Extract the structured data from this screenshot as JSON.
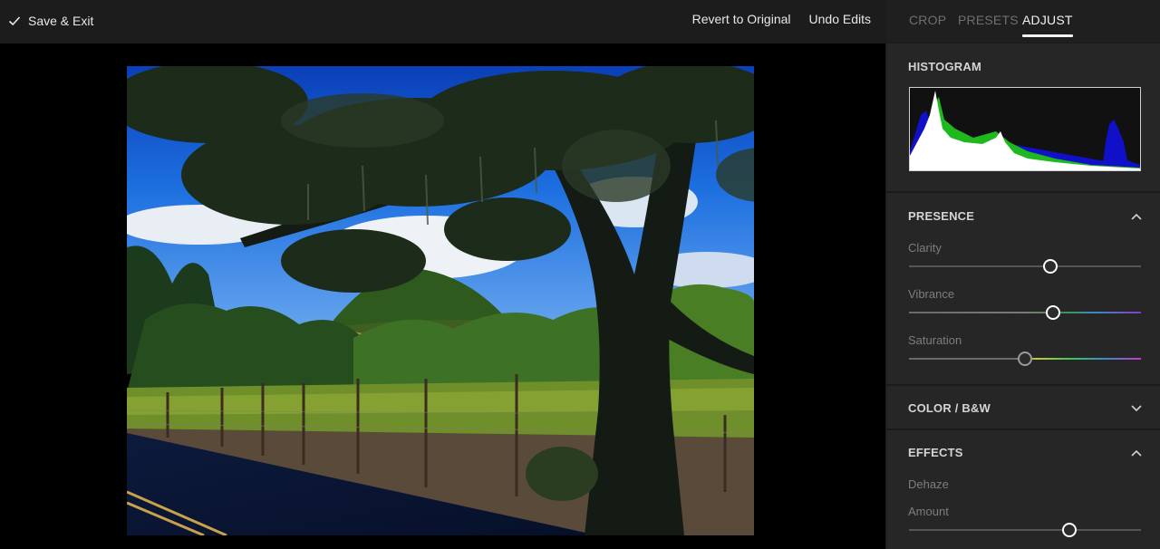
{
  "toolbar": {
    "save_exit_label": "Save & Exit",
    "revert_label": "Revert to Original",
    "undo_label": "Undo Edits"
  },
  "tabs": [
    {
      "label": "CROP",
      "active": false
    },
    {
      "label": "PRESETS",
      "active": false
    },
    {
      "label": "ADJUST",
      "active": true
    }
  ],
  "histogram": {
    "title": "HISTOGRAM"
  },
  "presence": {
    "title": "PRESENCE",
    "expanded": true,
    "sliders": [
      {
        "label": "Clarity",
        "value": 0.61
      },
      {
        "label": "Vibrance",
        "value": 0.62
      },
      {
        "label": "Saturation",
        "value": 0.5
      }
    ]
  },
  "color_bw": {
    "title": "COLOR / B&W",
    "expanded": false
  },
  "effects": {
    "title": "EFFECTS",
    "expanded": true,
    "sub_title": "Dehaze",
    "sliders": [
      {
        "label": "Amount",
        "value": 0.69
      }
    ]
  },
  "colors": {
    "panel_bg": "#262626",
    "topbar_bg": "#1c1c1c",
    "accent": "#ffffff",
    "histogram_blue": "#1010c8",
    "histogram_green": "#1fb91f"
  }
}
